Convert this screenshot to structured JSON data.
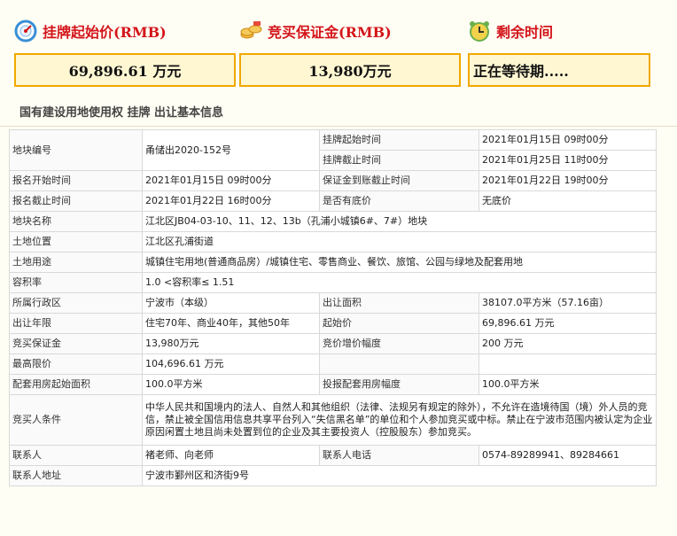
{
  "cards": {
    "start_price": {
      "title": "挂牌起始价(RMB)",
      "value": "69,896.61 万元"
    },
    "deposit": {
      "title": "竞买保证金(RMB)",
      "value": "13,980万元"
    },
    "remaining": {
      "title": "剩余时间",
      "value": "正在等待期....."
    }
  },
  "section_title": "国有建设用地使用权 挂牌 出让基本信息",
  "labels": {
    "parcel_no": "地块编号",
    "list_start": "挂牌起始时间",
    "list_end": "挂牌截止时间",
    "reg_start": "报名开始时间",
    "deposit_deadline": "保证金到账截止时间",
    "reg_end": "报名截止时间",
    "reserve": "是否有底价",
    "parcel_name": "地块名称",
    "location": "土地位置",
    "usage": "土地用途",
    "far": "容积率",
    "district": "所属行政区",
    "area": "出让面积",
    "term": "出让年限",
    "start_price": "起始价",
    "bid_deposit": "竞买保证金",
    "increment": "竞价增价幅度",
    "max_price": "最高限价",
    "housing_start": "配套用房起始面积",
    "housing_incr": "投报配套用房幅度",
    "conditions": "竞买人条件",
    "contact": "联系人",
    "phone": "联系人电话",
    "address": "联系人地址"
  },
  "values": {
    "parcel_no": "甬储出2020-152号",
    "list_start": "2021年01月15日 09时00分",
    "list_end": "2021年01月25日 11时00分",
    "reg_start": "2021年01月15日 09时00分",
    "deposit_deadline": "2021年01月22日 19时00分",
    "reg_end": "2021年01月22日 16时00分",
    "reserve": "无底价",
    "parcel_name": "江北区JB04-03-10、11、12、13b（孔浦小城镇6#、7#）地块",
    "location": "江北区孔浦街道",
    "usage": "城镇住宅用地(普通商品房）/城镇住宅、零售商业、餐饮、旅馆、公园与绿地及配套用地",
    "far": "1.0 <容积率≤ 1.51",
    "district": "宁波市（本级）",
    "area": "38107.0平方米（57.16亩）",
    "term": "住宅70年、商业40年，其他50年",
    "start_price": "69,896.61 万元",
    "bid_deposit": "13,980万元",
    "increment": "200 万元",
    "max_price": "104,696.61 万元",
    "housing_start": "100.0平方米",
    "housing_incr": "100.0平方米",
    "conditions": "中华人民共和国境内的法人、自然人和其他组织（法律、法规另有规定的除外），不允许在造境待国（境）外人员的竞信，禁止被全国信用信息共享平台列入“失信黑名单”的单位和个人参加竞买或中标。禁止在宁波市范围内被认定为企业原因闲置土地且尚未处置到位的企业及其主要投资人（控股股东）参加竞买。",
    "contact": "褚老师、向老师",
    "phone": "0574-89289941、89284661",
    "address": "宁波市鄞州区和济街9号"
  }
}
